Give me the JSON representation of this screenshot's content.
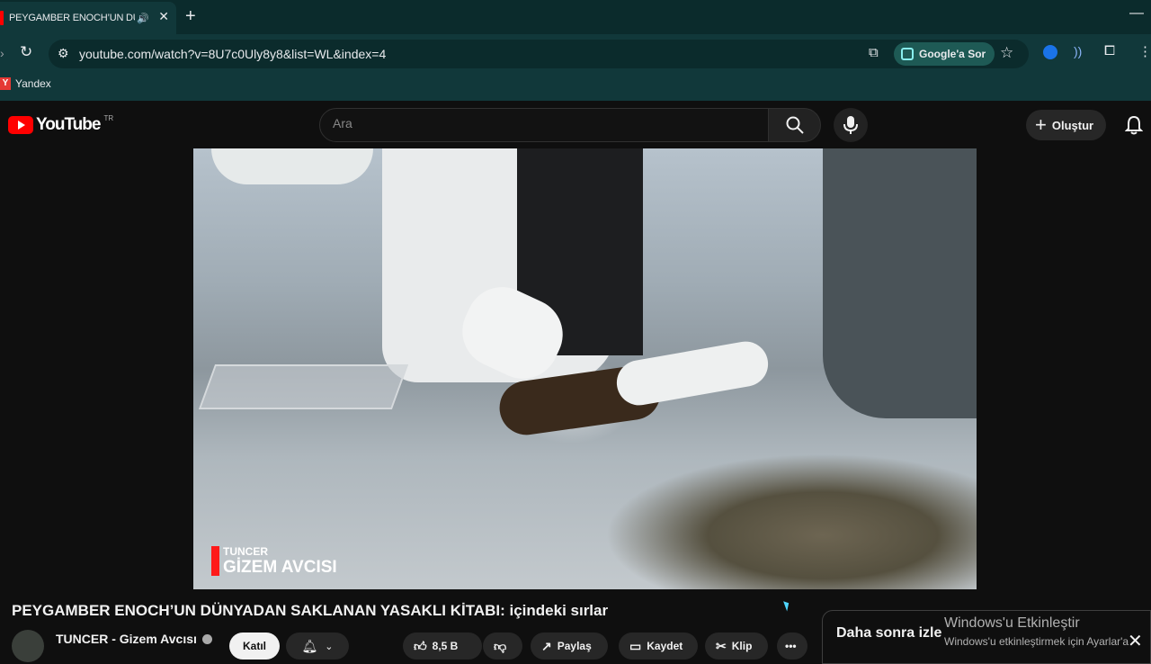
{
  "browser": {
    "tab_title": "PEYGAMBER ENOCH’UN DÜ",
    "url": "youtube.com/watch?v=8U7c0Uly8y8&list=WL&index=4",
    "ask_google_label": "Google'a Sor",
    "bookmarks": [
      {
        "label": "Yandex",
        "badge": "Y"
      }
    ]
  },
  "youtube": {
    "logo_text": "YouTube",
    "region": "TR",
    "search_placeholder": "Ara",
    "create_label": "Oluştur"
  },
  "video": {
    "watermark_line1": "TUNCER",
    "watermark_line2": "GİZEM AVCISI",
    "title": "PEYGAMBER ENOCH’UN DÜNYADAN SAKLANAN YASAKLI KİTABI: içindeki sırlar",
    "channel_name": "TUNCER - Gizem Avcısı",
    "join_label": "Katıl",
    "likes": "8,5 B",
    "share_label": "Paylaş",
    "save_label": "Kaydet",
    "clip_label": "Klip"
  },
  "sidebar": {
    "watch_later_label": "Daha sonra izle"
  },
  "windows": {
    "activate_title": "Windows'u Etkinleştir",
    "activate_body": "Windows'u etkinleştirmek için Ayarlar'a"
  },
  "colors": {
    "browser_chrome": "#11383a",
    "youtube_red": "#ff0000",
    "page_bg": "#0f0f0f"
  }
}
